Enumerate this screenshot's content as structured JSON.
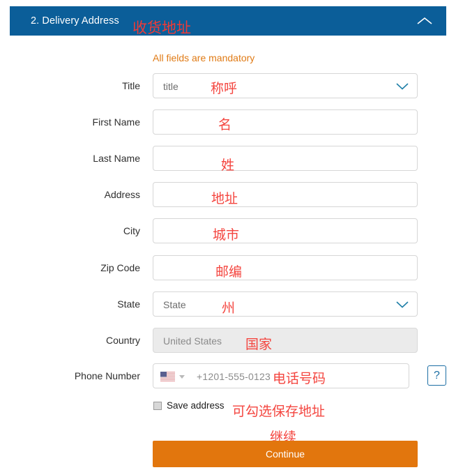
{
  "section": {
    "title": "2. Delivery Address",
    "collapse_icon": "chevron-up-icon",
    "annotation": "收货地址"
  },
  "notice": {
    "text": "All fields are mandatory",
    "color": "#e07b16"
  },
  "form": {
    "fields": [
      {
        "label": "Title",
        "value": "title",
        "type": "select",
        "annotation": "称呼",
        "disabled": false
      },
      {
        "label": "First Name",
        "value": "",
        "type": "text",
        "annotation": "名",
        "disabled": false
      },
      {
        "label": "Last Name",
        "value": "",
        "type": "text",
        "annotation": "姓",
        "disabled": false
      },
      {
        "label": "Address",
        "value": "",
        "type": "text",
        "annotation": "地址",
        "disabled": false
      },
      {
        "label": "City",
        "value": "",
        "type": "text",
        "annotation": "城市",
        "disabled": false
      },
      {
        "label": "Zip Code",
        "value": "",
        "type": "text",
        "annotation": "邮编",
        "disabled": false
      },
      {
        "label": "State",
        "value": "State",
        "type": "select",
        "annotation": "州",
        "disabled": false
      },
      {
        "label": "Country",
        "value": "United States",
        "type": "text",
        "annotation": "国家",
        "disabled": true
      }
    ],
    "phone": {
      "label": "Phone Number",
      "placeholder": "+1201-555-0123",
      "country_flag": "us-flag-icon",
      "country_caret": "caret-down-icon",
      "annotation": "电话号码",
      "help_label": "?"
    },
    "save_address": {
      "label": "Save address",
      "checked": false,
      "annotation": "可勾选保存地址"
    },
    "submit": {
      "label": "Continue",
      "annotation": "继续",
      "color": "#e2760d"
    }
  },
  "colors": {
    "header_blue": "#0b5e99",
    "annotation_red": "#f4453f",
    "notice_orange": "#e07b16",
    "accent_blue": "#1c6ea4"
  }
}
